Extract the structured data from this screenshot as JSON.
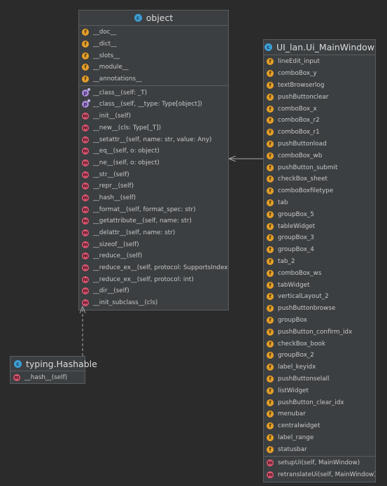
{
  "object_class": {
    "name": "object",
    "fields": [
      "__doc__",
      "__dict__",
      "__slots__",
      "__module__",
      "__annotations__"
    ],
    "methods": [
      {
        "kind": "p",
        "text": "__class__(self: _T)"
      },
      {
        "kind": "p",
        "text": "__class__(self, __type: Type[object])"
      },
      {
        "kind": "m",
        "text": "__init__(self)"
      },
      {
        "kind": "m",
        "text": "__new__(cls: Type[_T])"
      },
      {
        "kind": "m",
        "text": "__setattr__(self, name: str, value: Any)"
      },
      {
        "kind": "m",
        "text": "__eq__(self, o: object)"
      },
      {
        "kind": "m",
        "text": "__ne__(self, o: object)"
      },
      {
        "kind": "m",
        "text": "__str__(self)"
      },
      {
        "kind": "m",
        "text": "__repr__(self)"
      },
      {
        "kind": "m",
        "text": "__hash__(self)"
      },
      {
        "kind": "m",
        "text": "__format__(self, format_spec: str)"
      },
      {
        "kind": "m",
        "text": "__getattribute__(self, name: str)"
      },
      {
        "kind": "m",
        "text": "__delattr__(self, name: str)"
      },
      {
        "kind": "m",
        "text": "__sizeof__(self)"
      },
      {
        "kind": "m",
        "text": "__reduce__(self)"
      },
      {
        "kind": "m",
        "text": "__reduce_ex__(self, protocol: SupportsIndex)"
      },
      {
        "kind": "m",
        "text": "__reduce_ex__(self, protocol: int)"
      },
      {
        "kind": "m",
        "text": "__dir__(self)"
      },
      {
        "kind": "m",
        "text": "__init_subclass__(cls)"
      }
    ]
  },
  "window_class": {
    "name": "UI_lan.Ui_MainWindow",
    "fields": [
      "lineEdit_input",
      "comboBox_y",
      "textBrowserlog",
      "pushButtonclear",
      "comboBox_x",
      "comboBox_r2",
      "comboBox_r1",
      "pushButtonload",
      "comboBox_wb",
      "pushButton_submit",
      "checkBox_sheet",
      "comboBoxfiletype",
      "tab",
      "groupBox_5",
      "tableWidget",
      "groupBox_3",
      "groupBox_4",
      "tab_2",
      "comboBox_ws",
      "tabWidget",
      "verticalLayout_2",
      "pushButtonbrowse",
      "groupBox",
      "pushButton_confirm_idx",
      "checkBox_book",
      "groupBox_2",
      "label_keyidx",
      "pushButtonselall",
      "listWidget",
      "pushButton_clear_idx",
      "menubar",
      "centralwidget",
      "label_range",
      "statusbar"
    ],
    "methods": [
      {
        "kind": "m",
        "text": "setupUi(self, MainWindow)"
      },
      {
        "kind": "m",
        "text": "retranslateUi(self, MainWindow)"
      }
    ]
  },
  "hashable_class": {
    "name": "typing.Hashable",
    "methods": [
      {
        "kind": "m",
        "text": "__hash__(self)"
      }
    ]
  },
  "badges": {
    "class": "c",
    "field": "f",
    "method": "m",
    "property": "p"
  },
  "colors": {
    "background": "#2b2b2b",
    "box": "#3c3f41",
    "border": "#5a5d60",
    "field": "#e5a029",
    "method": "#d9556f",
    "property": "#a98ad8",
    "class": "#3d9fd6",
    "arrow": "#a9a9a9"
  }
}
